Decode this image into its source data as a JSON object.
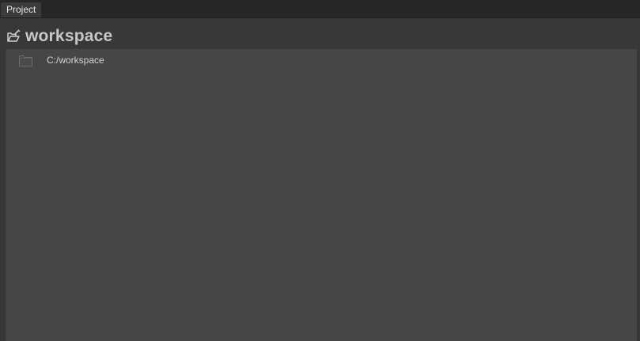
{
  "tabs": [
    {
      "label": "Project",
      "active": true
    }
  ],
  "header": {
    "title": "workspace",
    "icon": "open-folder-edit-icon"
  },
  "tree": {
    "items": [
      {
        "label": "C:/workspace",
        "icon": "folder-icon"
      }
    ]
  },
  "colors": {
    "background": "#383838",
    "tabbar": "#262626",
    "active_tab": "#3b3b3b",
    "tree_background": "#464646",
    "text": "#d2d2d2"
  }
}
